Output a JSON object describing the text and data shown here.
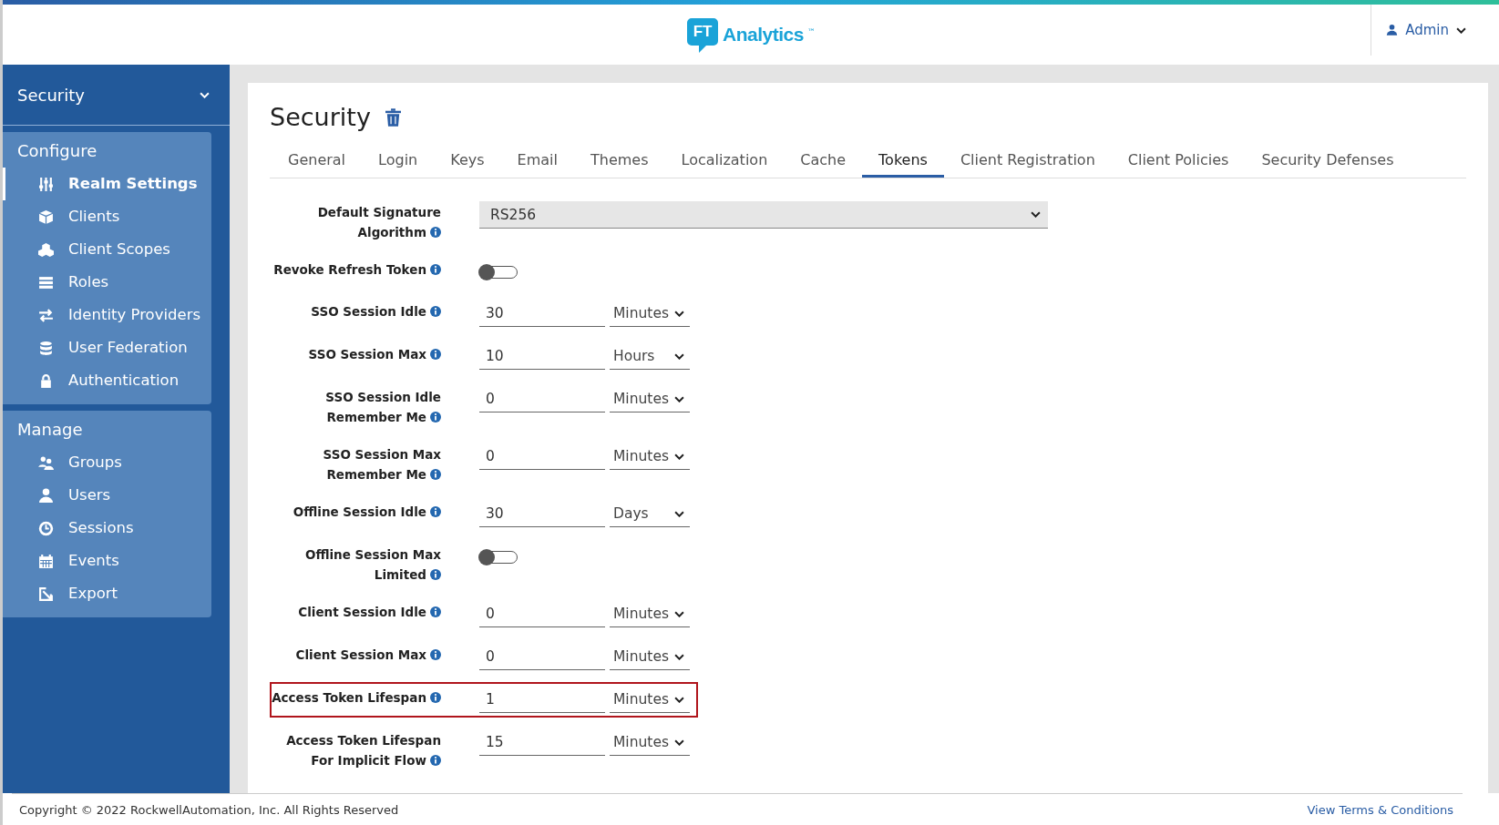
{
  "header": {
    "logo": {
      "mark": "FT",
      "name": "Analytics",
      "tm": "™"
    },
    "user": "Admin"
  },
  "sidebar": {
    "realm": "Security",
    "sections": [
      {
        "title": "Configure",
        "items": [
          {
            "label": "Realm Settings",
            "kind": "sliders",
            "selected": true
          },
          {
            "label": "Clients",
            "kind": "cube",
            "selected": false
          },
          {
            "label": "Client Scopes",
            "kind": "cubes",
            "selected": false
          },
          {
            "label": "Roles",
            "kind": "list",
            "selected": false
          },
          {
            "label": "Identity Providers",
            "kind": "exchange",
            "selected": false
          },
          {
            "label": "User Federation",
            "kind": "database",
            "selected": false
          },
          {
            "label": "Authentication",
            "kind": "lock",
            "selected": false
          }
        ]
      },
      {
        "title": "Manage",
        "items": [
          {
            "label": "Groups",
            "kind": "users",
            "selected": false
          },
          {
            "label": "Users",
            "kind": "user",
            "selected": false
          },
          {
            "label": "Sessions",
            "kind": "clock",
            "selected": false
          },
          {
            "label": "Events",
            "kind": "calendar",
            "selected": false
          },
          {
            "label": "Export",
            "kind": "export",
            "selected": false
          }
        ]
      }
    ]
  },
  "page": {
    "title": "Security",
    "tabs": [
      {
        "label": "General",
        "selected": false
      },
      {
        "label": "Login",
        "selected": false
      },
      {
        "label": "Keys",
        "selected": false
      },
      {
        "label": "Email",
        "selected": false
      },
      {
        "label": "Themes",
        "selected": false
      },
      {
        "label": "Localization",
        "selected": false
      },
      {
        "label": "Cache",
        "selected": false
      },
      {
        "label": "Tokens",
        "selected": true
      },
      {
        "label": "Client Registration",
        "selected": false
      },
      {
        "label": "Client Policies",
        "selected": false
      },
      {
        "label": "Security Defenses",
        "selected": false
      }
    ],
    "fields": [
      {
        "kind": "select",
        "label": "Default Signature Algorithm",
        "value": "RS256",
        "highlighted": false
      },
      {
        "kind": "toggle",
        "label": "Revoke Refresh Token",
        "on": false,
        "highlighted": false
      },
      {
        "kind": "duration",
        "label": "SSO Session Idle",
        "value": "30",
        "unit": "Minutes",
        "highlighted": false
      },
      {
        "kind": "duration",
        "label": "SSO Session Max",
        "value": "10",
        "unit": "Hours",
        "highlighted": false
      },
      {
        "kind": "duration",
        "label": "SSO Session Idle Remember Me",
        "value": "0",
        "unit": "Minutes",
        "highlighted": false
      },
      {
        "kind": "duration",
        "label": "SSO Session Max Remember Me",
        "value": "0",
        "unit": "Minutes",
        "highlighted": false
      },
      {
        "kind": "duration",
        "label": "Offline Session Idle",
        "value": "30",
        "unit": "Days",
        "highlighted": false
      },
      {
        "kind": "toggle",
        "label": "Offline Session Max Limited",
        "on": false,
        "highlighted": false
      },
      {
        "kind": "duration",
        "label": "Client Session Idle",
        "value": "0",
        "unit": "Minutes",
        "highlighted": false
      },
      {
        "kind": "duration",
        "label": "Client Session Max",
        "value": "0",
        "unit": "Minutes",
        "highlighted": false
      },
      {
        "kind": "duration",
        "label": "Access Token Lifespan",
        "value": "1",
        "unit": "Minutes",
        "highlighted": true
      },
      {
        "kind": "duration",
        "label": "Access Token Lifespan For Implicit Flow",
        "value": "15",
        "unit": "Minutes",
        "highlighted": false
      }
    ]
  },
  "footer": {
    "copyright": "Copyright © 2022 RockwellAutomation, Inc. All Rights Reserved",
    "link": "View Terms & Conditions"
  }
}
